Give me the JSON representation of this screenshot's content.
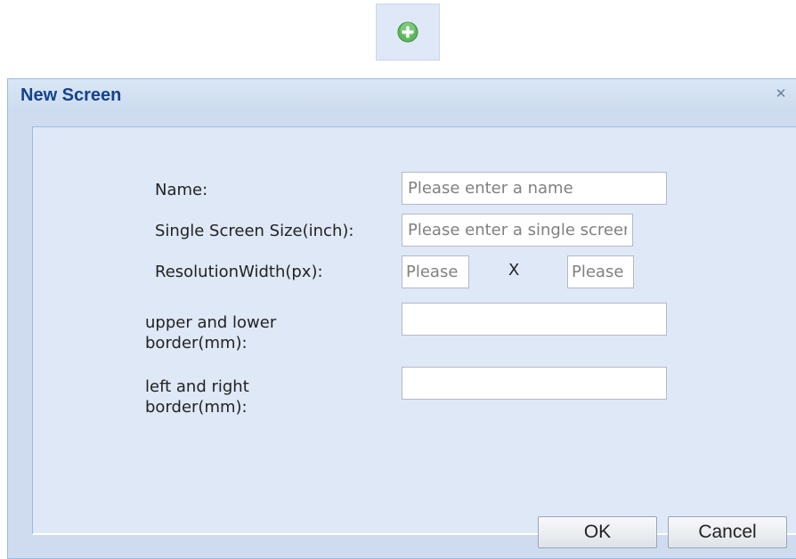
{
  "toolbar": {
    "add_icon": "plus-circle-icon",
    "add_color": "#4caf50"
  },
  "dialog": {
    "title": "New Screen",
    "close_glyph": "✕",
    "fields": {
      "name_label": "Name:",
      "name_placeholder": "Please enter a name",
      "size_label": "Single Screen Size(inch):",
      "size_placeholder": "Please enter a single screen size",
      "resolution_label": "ResolutionWidth(px):",
      "resolution_width_placeholder": "Please",
      "resolution_times": "X",
      "resolution_height_placeholder": "Please",
      "upper_lower_label_line1": "upper and lower",
      "upper_lower_label_line2": "border(mm):",
      "upper_lower_value": "",
      "left_right_label_line1": "left and right",
      "left_right_label_line2": "border(mm):",
      "left_right_value": ""
    },
    "buttons": {
      "ok": "OK",
      "cancel": "Cancel"
    }
  }
}
